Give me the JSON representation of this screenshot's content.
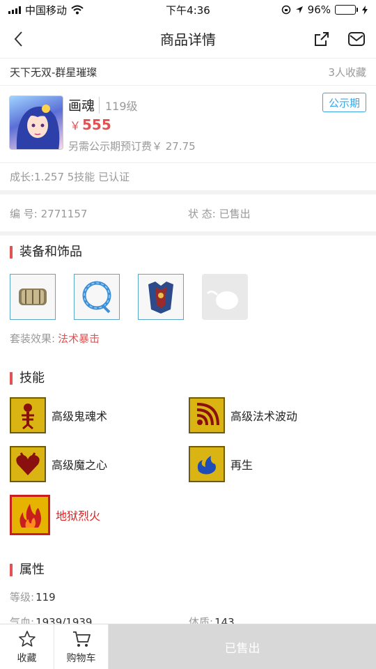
{
  "status_bar": {
    "carrier": "中国移动",
    "time": "下午4:36",
    "battery_pct": "96%",
    "battery_level": 0.96
  },
  "nav": {
    "title": "商品详情",
    "back_icon": "chevron-left-icon",
    "share_icon": "share-icon",
    "mail_icon": "mail-icon"
  },
  "store": {
    "name": "天下无双-群星璀璨",
    "fav_count": "3人收藏"
  },
  "item": {
    "name": "画魂",
    "level": "119级",
    "badge": "公示期",
    "price_symbol": "￥",
    "price": "555",
    "fee": "另需公示期预订费￥ 27.75",
    "growth": "成长:1.257 5技能 已认证"
  },
  "info": {
    "id_label": "编 号:",
    "id_value": "2771157",
    "state_label": "状 态:",
    "state_value": "已售出"
  },
  "equipment": {
    "title": "装备和饰品",
    "items": [
      "equipment-slot-1",
      "equipment-slot-2",
      "equipment-slot-3",
      "equipment-slot-empty"
    ],
    "set_label": "套装效果:",
    "set_value": "法术暴击"
  },
  "skills": {
    "title": "技能",
    "items": [
      {
        "name": "高级鬼魂术",
        "icon": "skeleton-icon"
      },
      {
        "name": "高级法术波动",
        "icon": "wave-icon"
      },
      {
        "name": "高级魔之心",
        "icon": "heart-icon"
      },
      {
        "name": "再生",
        "icon": "regen-icon"
      },
      {
        "name": "地狱烈火",
        "icon": "fire-icon"
      }
    ]
  },
  "attributes": {
    "title": "属性",
    "level_label": "等级:",
    "level_value": "119",
    "hp_label": "气血:",
    "hp_value": "1939/1939",
    "con_label": "体质:",
    "con_value": "143"
  },
  "bottom": {
    "fav_label": "收藏",
    "cart_label": "购物车",
    "sold_label": "已售出"
  },
  "colors": {
    "accent": "#e15252",
    "badge": "#3ba6e6",
    "skill_gold": "#d9b413"
  }
}
